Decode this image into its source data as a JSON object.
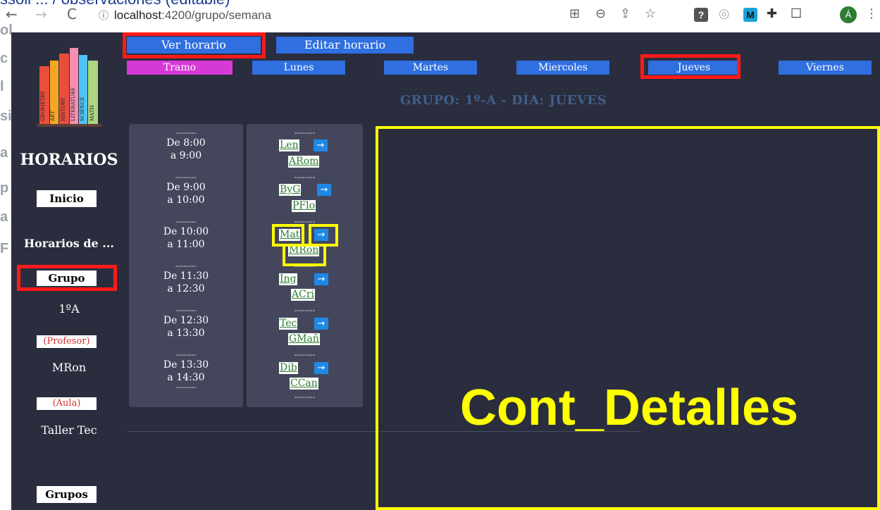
{
  "browser": {
    "doc_header": "ssoli ... / observaciones (editable)",
    "url_host": "localhost",
    "url_rest": ":4200/grupo/semana",
    "avatar_letter": "Á",
    "left_cut_letters": [
      "ol",
      "c",
      "l",
      "si",
      "a",
      "p",
      "a",
      "F"
    ]
  },
  "sidebar": {
    "title": "HORARIOS",
    "inicio": "Inicio",
    "horarios_de": "Horarios de ...",
    "grupo": "Grupo",
    "grupo_value": "1ºA",
    "profesor_tag": "(Profesor)",
    "profesor_value": "MRon",
    "aula_tag": "(Aula)",
    "aula_value": "Taller Tec",
    "grupos": "Grupos",
    "logo_books": [
      "GEOMETRY",
      "ART",
      "HISTORY",
      "LITERATURE",
      "SCIENCE",
      "MATH"
    ]
  },
  "toolbar": {
    "ver_horario": "Ver horario",
    "editar_horario": "Editar horario"
  },
  "days": {
    "tramo": "Tramo",
    "lunes": "Lunes",
    "martes": "Martes",
    "miercoles": "Miercoles",
    "jueves": "Jueves",
    "viernes": "Viernes"
  },
  "heading": "GRUPO: 1º-A - DÍA: JUEVES",
  "slots": [
    {
      "from": "De 8:00",
      "to": "a 9:00",
      "subject": "Len",
      "teacher": "ARom"
    },
    {
      "from": "De 9:00",
      "to": "a 10:00",
      "subject": "ByG",
      "teacher": "PFlo"
    },
    {
      "from": "De 10:00",
      "to": "a 11:00",
      "subject": "Mat",
      "teacher": "MRon"
    },
    {
      "from": "De 11:30",
      "to": "a 12:30",
      "subject": "Ing",
      "teacher": "ACri"
    },
    {
      "from": "De 12:30",
      "to": "a 13:30",
      "subject": "Tec",
      "teacher": "GMañ"
    },
    {
      "from": "De 13:30",
      "to": "a 14:30",
      "subject": "Dib",
      "teacher": "CCan"
    }
  ],
  "dash": "--------",
  "arrow_glyph": "→",
  "annotation_label": "Cont_Detalles",
  "colors": {
    "panel_bg": "#2a2d3e",
    "button_blue": "#2f6fe0",
    "tramo_magenta": "#d63ad6",
    "highlight_red": "#ff1a1a",
    "highlight_yellow": "#ffff00",
    "subject_green": "#2e7d32"
  }
}
